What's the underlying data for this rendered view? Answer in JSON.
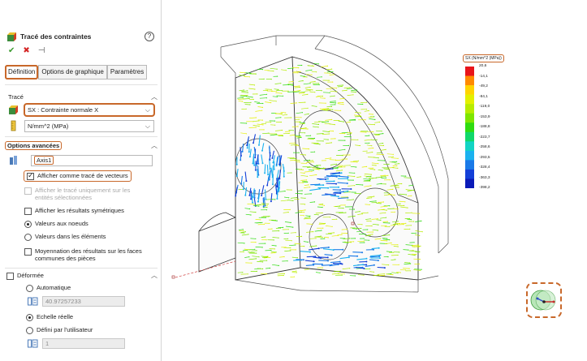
{
  "panel": {
    "title": "Tracé des contraintes",
    "help_label": "?",
    "tabs": [
      "Définition",
      "Options de graphique",
      "Paramètres"
    ],
    "trace": {
      "section_title": "Tracé",
      "component": "SX : Contrainte normale X",
      "unit": "N/mm^2 (MPa)"
    },
    "advanced": {
      "section_title": "Options avancées",
      "axis_value": "Axis1",
      "show_vectors": "Afficher comme tracé de vecteurs",
      "selected_only": "Afficher le tracé uniquement sur les entités sélectionnées",
      "symmetric": "Afficher les résultats symétriques",
      "node_values": "Valeurs aux noeuds",
      "element_values": "Valeurs dans les éléments",
      "average": "Moyennation des résultats sur les faces communes des pièces"
    },
    "deformed": {
      "section_title": "Déformée",
      "automatic": "Automatique",
      "auto_value": "40.97257233",
      "true_scale": "Echelle réelle",
      "user_defined": "Défini par l'utilisateur",
      "user_value": "1"
    }
  },
  "legend": {
    "title": "SX (N/mm^2 (MPa))",
    "values": [
      "20,6",
      "-14,1",
      "-49,2",
      "-84,1",
      "-119,0",
      "-153,9",
      "-188,8",
      "-223,7",
      "-258,6",
      "-293,5",
      "-328,4",
      "-363,3",
      "-398,2"
    ],
    "colors": [
      "#e8141a",
      "#ff8a00",
      "#ffd400",
      "#e3f000",
      "#b8ec00",
      "#7ee600",
      "#2fdc10",
      "#10d86a",
      "#12d4c4",
      "#1bb2ef",
      "#1a7ae8",
      "#1440d8",
      "#0a1ab8"
    ]
  },
  "accent_color": "#c8682a"
}
